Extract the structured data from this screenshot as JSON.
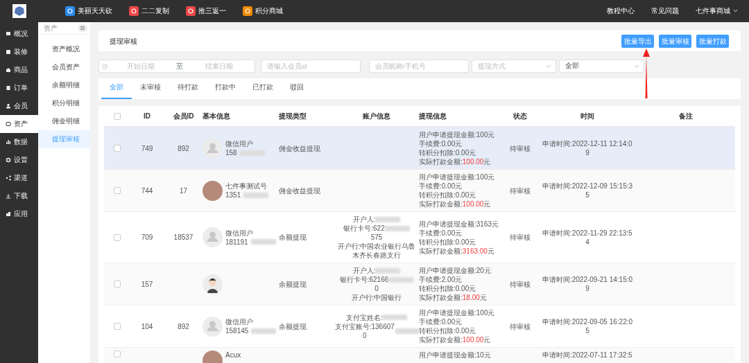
{
  "topbar": {
    "apps": [
      {
        "label": "美丽天天砍",
        "color": "#2d8cf0"
      },
      {
        "label": "二二复制",
        "color": "#ed4747"
      },
      {
        "label": "推三返一",
        "color": "#ed4747"
      },
      {
        "label": "积分商城",
        "color": "#f08a00"
      }
    ],
    "links": [
      "教程中心",
      "常见问题"
    ],
    "shop": "七件事商城"
  },
  "sidebar": {
    "items": [
      {
        "label": "概况",
        "selected": false
      },
      {
        "label": "装修",
        "selected": false
      },
      {
        "label": "商品",
        "selected": false
      },
      {
        "label": "订单",
        "selected": false
      },
      {
        "label": "会员",
        "selected": false
      },
      {
        "label": "资产",
        "selected": true
      },
      {
        "label": "数据",
        "selected": false
      },
      {
        "label": "设置",
        "selected": false
      },
      {
        "label": "渠道",
        "selected": false
      },
      {
        "label": "下载",
        "selected": false
      },
      {
        "label": "应用",
        "selected": false
      }
    ]
  },
  "subnav": {
    "title": "资产",
    "items": [
      {
        "label": "资产概况",
        "selected": false
      },
      {
        "label": "会员资产",
        "selected": false
      },
      {
        "label": "余额明细",
        "selected": false
      },
      {
        "label": "积分明细",
        "selected": false
      },
      {
        "label": "佣金明细",
        "selected": false
      },
      {
        "label": "提现审核",
        "selected": true
      }
    ]
  },
  "page": {
    "title": "提现审核",
    "buttons": [
      "批量导出",
      "批量审核",
      "批量打款"
    ]
  },
  "filters": {
    "start_date": {
      "placeholder": "开始日期"
    },
    "range_separator": "至",
    "end_date": {
      "placeholder": "结束日期"
    },
    "member_id": {
      "placeholder": "请输入会员id"
    },
    "nickname": {
      "placeholder": "会员昵称/手机号"
    },
    "method": {
      "placeholder": "提现方式"
    },
    "status": {
      "value": "全部"
    }
  },
  "select_all": {
    "checked": false
  },
  "tabs": [
    {
      "label": "全部",
      "selected": true
    },
    {
      "label": "未审核",
      "selected": false
    },
    {
      "label": "待打款",
      "selected": false
    },
    {
      "label": "打款中",
      "selected": false
    },
    {
      "label": "已打款",
      "selected": false
    },
    {
      "label": "驳回",
      "selected": false
    }
  ],
  "table": {
    "columns": [
      "ID",
      "会员ID",
      "基本信息",
      "提现类型",
      "账户信息",
      "提现信息",
      "状态",
      "时间",
      "备注"
    ],
    "rows": [
      {
        "selected": true,
        "checked": false,
        "id": "749",
        "member_id": "892",
        "avatar": {
          "kind": "default"
        },
        "name": "微信用户",
        "phone": "158",
        "type": "佣金收益提现",
        "account": [],
        "apply": "用户申请提现金额:100元",
        "fee": "手续费:0.00元",
        "points": "转积分扣除:0.00元",
        "actual_label": "实际打款金额:",
        "actual_amount": "100.00",
        "actual_unit": "元",
        "status": "待审核",
        "time": "申请时间:2022-12-11 12:14:09"
      },
      {
        "selected": false,
        "checked": false,
        "id": "744",
        "member_id": "17",
        "avatar": {
          "kind": "photo"
        },
        "name": "七件事测试号",
        "phone": "1351",
        "type": "佣金收益提现",
        "account": [],
        "apply": "用户申请提现金额:100元",
        "fee": "手续费:0.00元",
        "points": "转积分扣除:0.00元",
        "actual_label": "实际打款金额:",
        "actual_amount": "100.00",
        "actual_unit": "元",
        "status": "待审核",
        "time": "申请时间:2022-12-09 15:15:35"
      },
      {
        "selected": false,
        "checked": false,
        "id": "709",
        "member_id": "18537",
        "avatar": {
          "kind": "default"
        },
        "name": "微信用户",
        "phone": "181191",
        "type": "余额提现",
        "account": [
          {
            "text": "开户人:",
            "blur": true
          },
          {
            "text": "银行卡号:622",
            "blur": true
          },
          {
            "text": "575",
            "blur": false
          },
          {
            "text": "开户行:中国农业银行乌鲁木齐长春路支行",
            "blur": false
          }
        ],
        "apply": "用户申请提现金额:3163元",
        "fee": "手续费:0.00元",
        "points": "转积分扣除:0.00元",
        "actual_label": "实际打款金额:",
        "actual_amount": "3163.00",
        "actual_unit": "元",
        "status": "待审核",
        "time": "申请时间:2022-11-29 22:13:54"
      },
      {
        "selected": false,
        "checked": false,
        "id": "157",
        "member_id": "",
        "avatar": {
          "kind": "cartoon"
        },
        "name": "",
        "phone": "",
        "type": "余额提现",
        "account": [
          {
            "text": "开户人:",
            "blur": true
          },
          {
            "text": "银行卡号:62166",
            "blur": true
          },
          {
            "text": "0",
            "blur": false
          },
          {
            "text": "开户行:中国银行",
            "blur": false
          }
        ],
        "apply": "用户申请提现金额:20元",
        "fee": "手续费:2.00元",
        "points": "转积分扣除:0.00元",
        "actual_label": "实际打款金额:",
        "actual_amount": "18.00",
        "actual_unit": "元",
        "status": "待审核",
        "time": "申请时间:2022-09-21 14:15:09"
      },
      {
        "selected": false,
        "checked": false,
        "id": "104",
        "member_id": "892",
        "avatar": {
          "kind": "default"
        },
        "name": "微信用户",
        "phone": "158145",
        "type": "余额提现",
        "account": [
          {
            "text": "支付宝姓名:",
            "blur": true
          },
          {
            "text": "支付宝账号:1366070",
            "blur": true
          }
        ],
        "apply": "用户申请提现金额:100元",
        "fee": "手续费:0.00元",
        "points": "转积分扣除:0.00元",
        "actual_label": "实际打款金额:",
        "actual_amount": "100.00",
        "actual_unit": "元",
        "status": "待审核",
        "time": "申请时间:2022-09-05 16:22:05"
      },
      {
        "selected": false,
        "checked": false,
        "id": "",
        "member_id": "",
        "avatar": {
          "kind": "photo"
        },
        "name": "Acux",
        "phone": "",
        "type": "",
        "account": [],
        "apply": "用户申请提现金额:10元",
        "fee": "",
        "points": "",
        "actual_label": "",
        "actual_amount": "",
        "actual_unit": "",
        "status": "",
        "time": "申请时间:2022-07-11 17:32:5"
      }
    ]
  },
  "annotation": {
    "arrow": true
  }
}
